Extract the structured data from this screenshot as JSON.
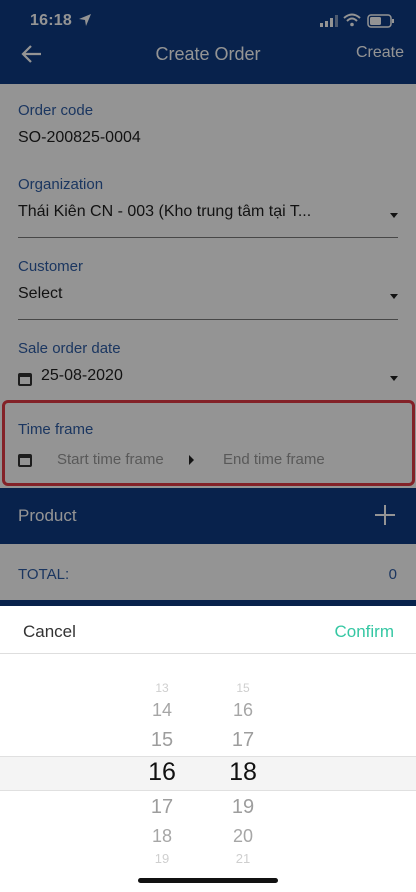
{
  "status_bar": {
    "time": "16:18"
  },
  "nav": {
    "title": "Create Order",
    "action_label": "Create"
  },
  "form": {
    "order_code": {
      "label": "Order code",
      "value": "SO-200825-0004"
    },
    "organization": {
      "label": "Organization",
      "value": "Thái Kiên CN - 003  (Kho trung tâm tại T..."
    },
    "customer": {
      "label": "Customer",
      "value": "Select"
    },
    "sale_order_date": {
      "label": "Sale order date",
      "value": "25-08-2020"
    },
    "time_frame": {
      "label": "Time frame",
      "start_placeholder": "Start time frame",
      "end_placeholder": "End time frame"
    }
  },
  "product": {
    "label": "Product"
  },
  "total": {
    "label": "TOTAL:",
    "value": "0"
  },
  "picker": {
    "cancel_label": "Cancel",
    "confirm_label": "Confirm",
    "hours": [
      "13",
      "14",
      "15",
      "16",
      "17",
      "18",
      "19"
    ],
    "minutes": [
      "15",
      "16",
      "17",
      "18",
      "19",
      "20",
      "21"
    ],
    "selected_hour": "16",
    "selected_minute": "18"
  },
  "colors": {
    "primary": "#0f3c84",
    "accent": "#35c7a3",
    "highlight": "#e23b46",
    "label": "#2f5ea6"
  }
}
